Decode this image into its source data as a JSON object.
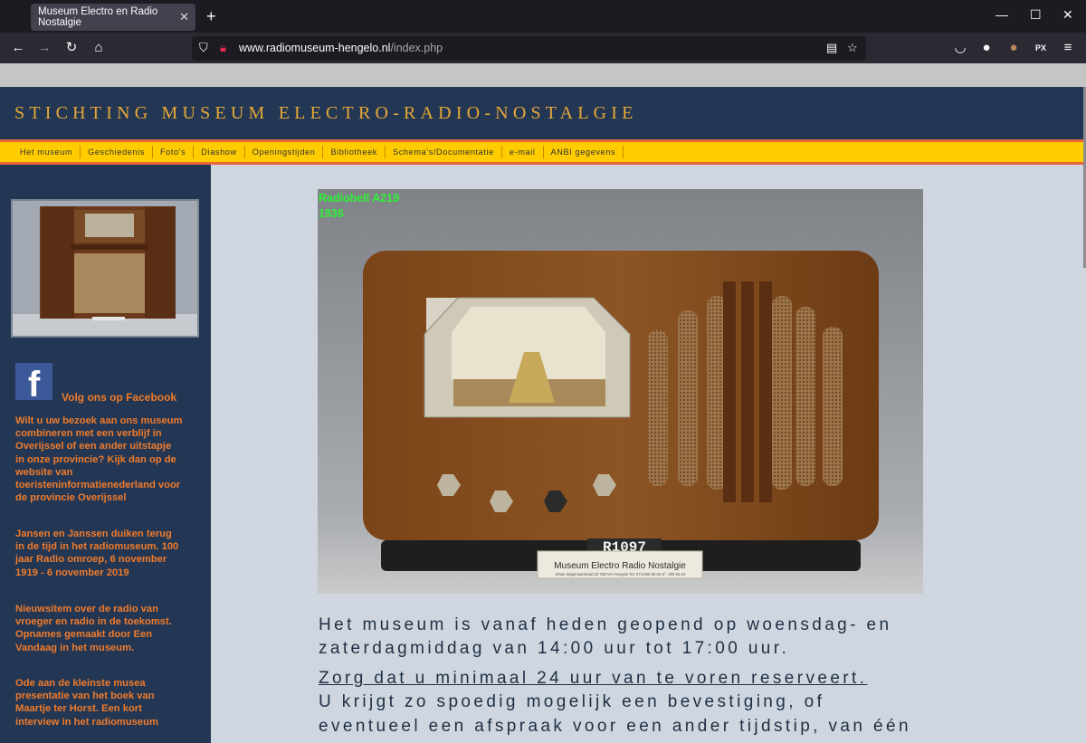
{
  "browser": {
    "tab_title": "Museum Electro en Radio Nostalgie",
    "url_host": "www.radiomuseum-hengelo.nl",
    "url_path": "/index.php"
  },
  "site": {
    "title": "STICHTING MUSEUM ELECTRO-RADIO-NOSTALGIE",
    "menu": [
      "Het museum",
      "Geschiedenis",
      "Foto's",
      "Diashow",
      "Openingstijden",
      "Bibliotheek",
      "Schema's/Documentatie",
      "e-mail",
      "ANBI gegevens"
    ]
  },
  "sidebar": {
    "facebook_letter": "f",
    "facebook_label": "Volg ons op Facebook",
    "items": [
      "Wilt u uw bezoek aan ons museum combineren met een verblijf in Overijssel of een ander uitstapje in onze provincie? Kijk dan op de website van toeristeninformatienederland voor de provincie Overijssel",
      "Jansen en Janssen duiken terug in de tijd in het radiomuseum. 100 jaar Radio omroep, 6 november 1919 - 6 november 2019",
      "Nieuwsitem over de radio van vroeger en radio in de toekomst. Opnames gemaakt door Een Vandaag in het museum.",
      "Ode aan de kleinste musea presentatie van het boek van Maartje ter Horst. Een kort interview in het radiomuseum"
    ]
  },
  "hero": {
    "caption_line1": "Radiobell  A219",
    "caption_line2": "1936",
    "tag": "R1097",
    "plate_title": "Museum Electro Radio Nostalgie",
    "plate_sub": "Johan Wagenaarstraat 26  7557VH Hengelo  Tel. 074-250 55 35 of  - 290 94 43"
  },
  "main": {
    "line1": "Het museum is vanaf heden geopend op woensdag- en",
    "line2": "zaterdagmiddag van 14:00 uur tot 17:00 uur.",
    "link": "Zorg dat u minimaal 24 uur van te voren reserveert.",
    "line3": "U krijgt zo spoedig mogelijk een bevestiging, of",
    "line4": "eventueel een afspraak voor een ander tijdstip, van één"
  },
  "colors": {
    "header_bg": "#233754",
    "title_gold": "#e7a836",
    "menu_yellow": "#ffcc00",
    "menu_border": "#e8663a",
    "sidebar_text": "#f07b2b",
    "caption_green": "#2df236"
  }
}
